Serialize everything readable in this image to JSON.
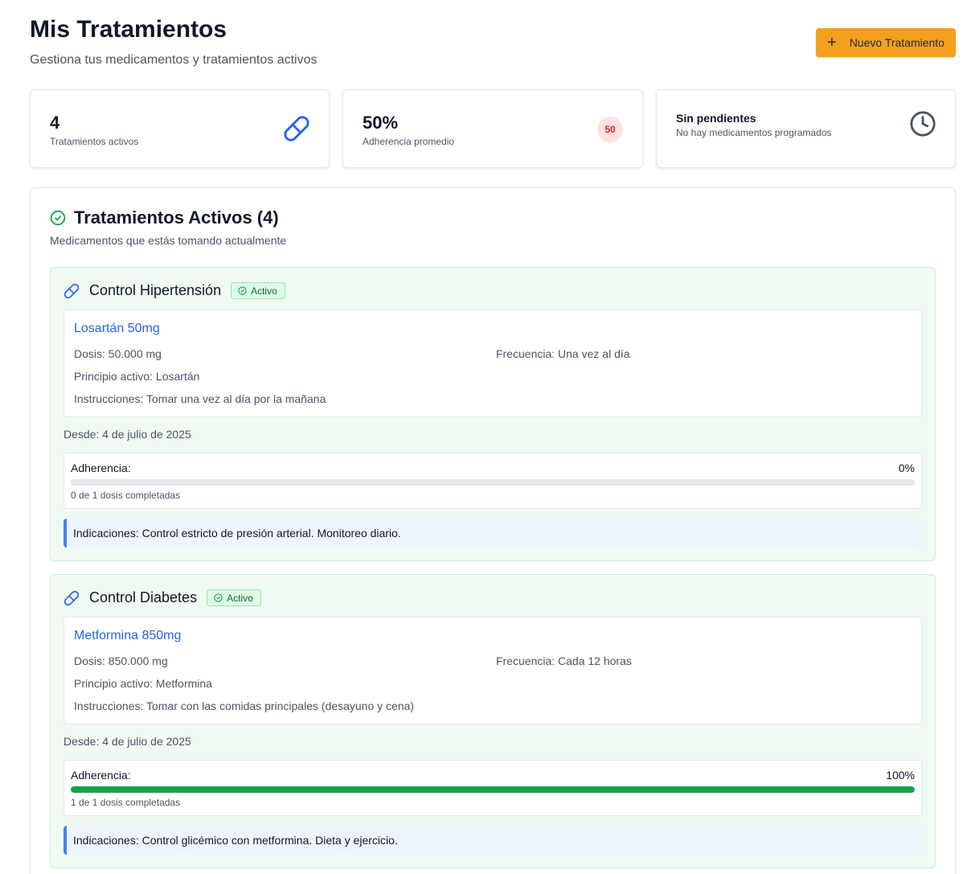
{
  "header": {
    "title": "Mis Tratamientos",
    "subtitle": "Gestiona tus medicamentos y tratamientos activos",
    "new_button_label": "Nuevo Tratamiento"
  },
  "stats": {
    "active": {
      "value": "4",
      "label": "Tratamientos activos",
      "icon": "pill-icon"
    },
    "adherence": {
      "value": "50%",
      "label": "Adherencia promedio",
      "badge": "50",
      "badge_color": "#dc2626"
    },
    "pending": {
      "title": "Sin pendientes",
      "subtitle": "No hay medicamentos programados",
      "icon": "clock-icon"
    }
  },
  "section": {
    "title": "Tratamientos Activos (4)",
    "subtitle": "Medicamentos que estás tomando actualmente"
  },
  "treatments": [
    {
      "name": "Control Hipertensión",
      "status": "Activo",
      "medication": "Losartán 50mg",
      "dose": "Dosis: 50.000 mg",
      "frequency": "Frecuencia: Una vez al día",
      "active_ingredient": "Principio activo: Losartán",
      "instructions": "Instrucciones: Tomar una vez al día por la mañana",
      "since": "Desde: 4 de julio de 2025",
      "adherence_label": "Adherencia:",
      "adherence_pct": "0%",
      "adherence_fraction": 0,
      "doses": "0 de 1 dosis completadas",
      "indications": "Indicaciones: Control estricto de presión arterial. Monitoreo diario."
    },
    {
      "name": "Control Diabetes",
      "status": "Activo",
      "medication": "Metformina 850mg",
      "dose": "Dosis: 850.000 mg",
      "frequency": "Frecuencia: Cada 12 horas",
      "active_ingredient": "Principio activo: Metformina",
      "instructions": "Instrucciones: Tomar con las comidas principales (desayuno y cena)",
      "since": "Desde: 4 de julio de 2025",
      "adherence_label": "Adherencia:",
      "adherence_pct": "100%",
      "adherence_fraction": 1,
      "doses": "1 de 1 dosis completadas",
      "indications": "Indicaciones: Control glicémico con metformina. Dieta y ejercicio."
    }
  ],
  "colors": {
    "accent_orange": "#f4a01e",
    "link_blue": "#2563eb",
    "success_green": "#16a34a",
    "card_green_bg": "#effbf2"
  }
}
